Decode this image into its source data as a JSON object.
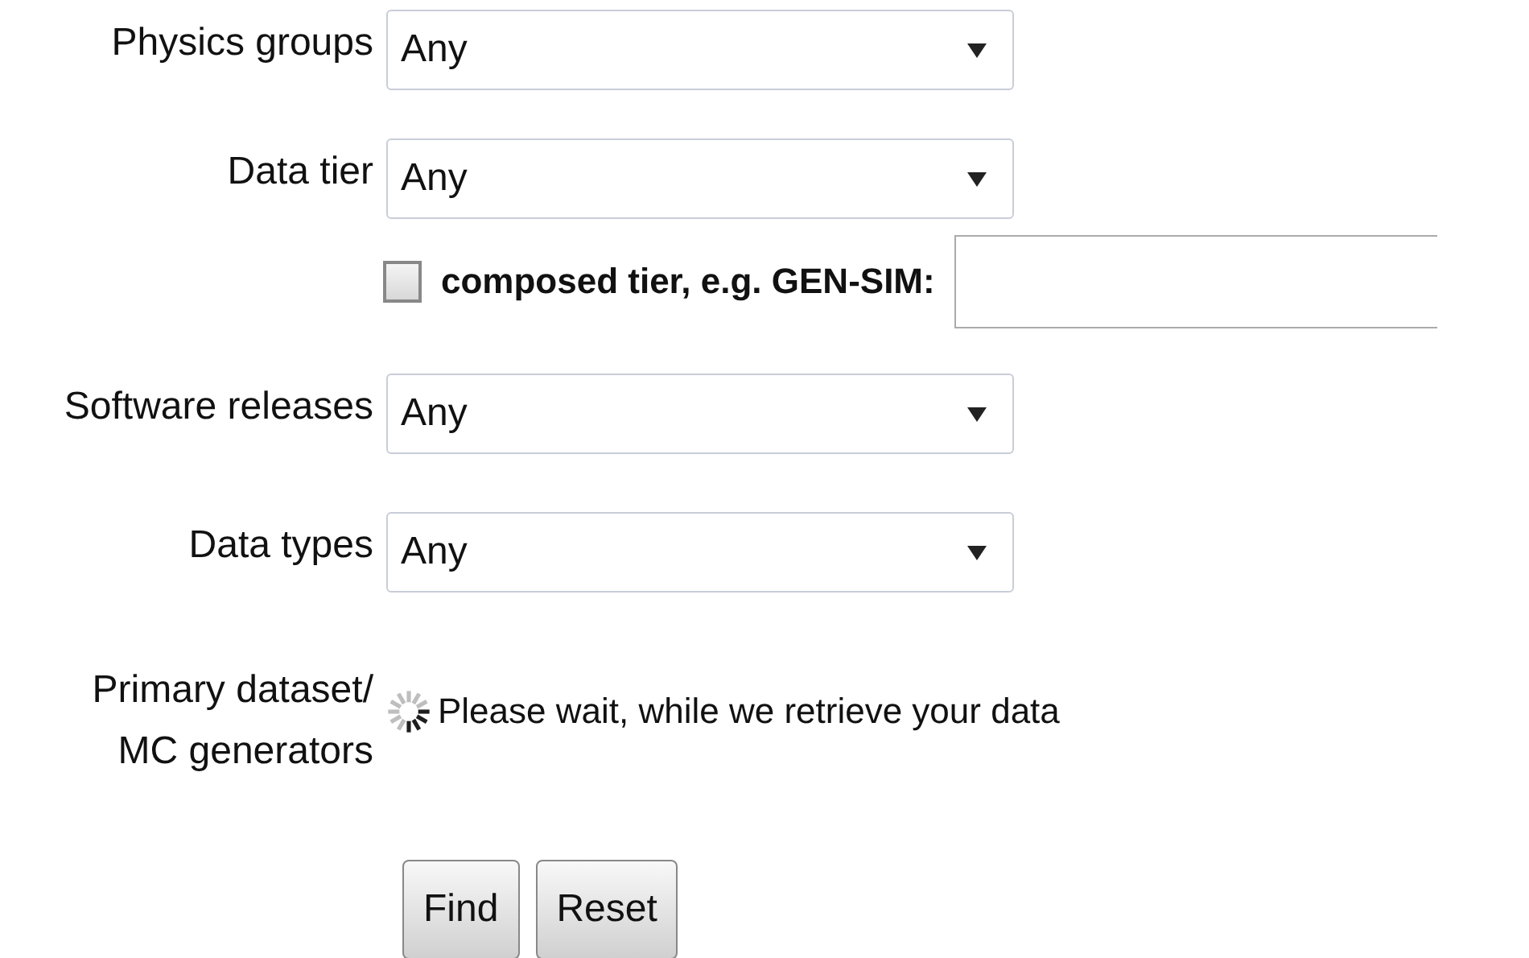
{
  "form": {
    "rows": [
      {
        "kind": "select",
        "label": "Physics groups",
        "value": "Any"
      },
      {
        "kind": "select",
        "label": "Data tier",
        "value": "Any"
      },
      {
        "kind": "checkbox",
        "label": "composed tier, e.g. GEN-SIM:",
        "checked": false
      },
      {
        "kind": "select",
        "label": "Software releases",
        "value": "Any"
      },
      {
        "kind": "select",
        "label": "Data types",
        "value": "Any"
      },
      {
        "kind": "loading",
        "label": "Primary dataset/\nMC generators",
        "message": "Please wait, while we retrieve your data"
      }
    ],
    "buttons": [
      "Find",
      "Reset"
    ]
  }
}
